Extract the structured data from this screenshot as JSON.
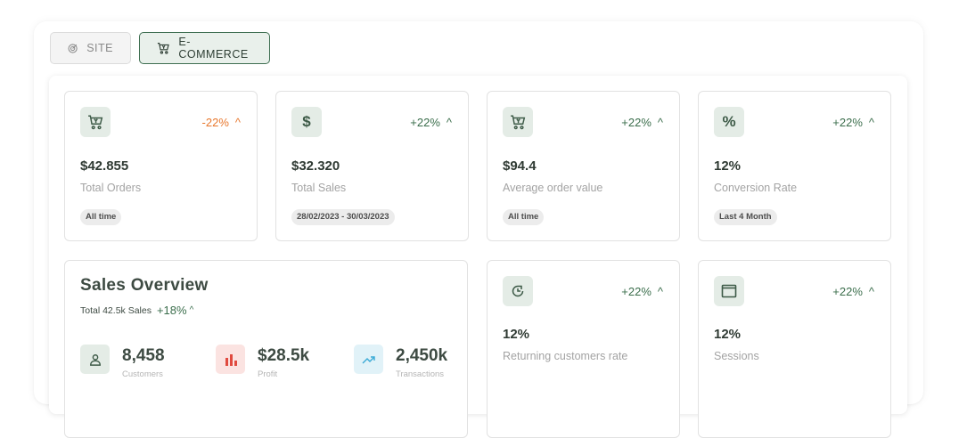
{
  "tabs": [
    {
      "label": "SITE",
      "icon": "target-icon",
      "active": false
    },
    {
      "label": "E-COMMERCE",
      "icon": "cart-icon",
      "active": true
    }
  ],
  "stats": [
    {
      "icon": "cart-icon",
      "delta": "-22%",
      "delta_dir": "up",
      "negative": true,
      "value": "$42.855",
      "label": "Total Orders",
      "badge": "All time"
    },
    {
      "icon": "dollar-icon",
      "delta": "+22%",
      "delta_dir": "up",
      "negative": false,
      "value": "$32.320",
      "label": "Total Sales",
      "badge": "28/02/2023 - 30/03/2023"
    },
    {
      "icon": "cart-icon",
      "delta": "+22%",
      "delta_dir": "up",
      "negative": false,
      "value": "$94.4",
      "label": "Average order value",
      "badge": "All time"
    },
    {
      "icon": "percent-icon",
      "delta": "+22%",
      "delta_dir": "up",
      "negative": false,
      "value": "12%",
      "label": "Conversion Rate",
      "badge": "Last 4 Month"
    }
  ],
  "sales_overview": {
    "title": "Sales Overview",
    "subtitle": "Total 42.5k Sales",
    "change": "+18%",
    "metrics": [
      {
        "icon": "user-icon",
        "value": "8,458",
        "label": "Customers",
        "color": "#e4ece6",
        "icon_color": "#3d5a47"
      },
      {
        "icon": "bar-chart-icon",
        "value": "$28.5k",
        "label": "Profit",
        "color": "#fbe3e1",
        "icon_color": "#e04a3f"
      },
      {
        "icon": "trending-up-icon",
        "value": "2,450k",
        "label": "Transactions",
        "color": "#e1f2f8",
        "icon_color": "#3aaad6"
      }
    ]
  },
  "small_stats": [
    {
      "icon": "refresh-icon",
      "delta": "+22%",
      "value": "12%",
      "label": "Returning customers rate"
    },
    {
      "icon": "window-icon",
      "delta": "+22%",
      "value": "12%",
      "label": "Sessions"
    }
  ],
  "colors": {
    "accent": "#3b6e4c",
    "negative": "#e8782e",
    "icon_bg": "#e4ece6"
  }
}
